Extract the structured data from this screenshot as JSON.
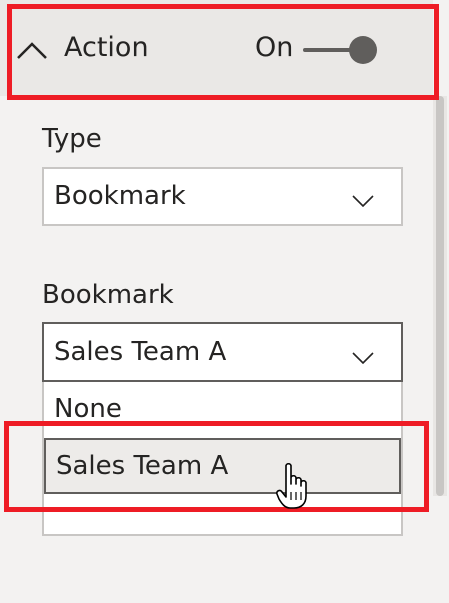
{
  "action": {
    "title": "Action",
    "toggle_label": "On",
    "toggle_state": true,
    "chevron_icon": "chevron-up-icon"
  },
  "type_field": {
    "label": "Type",
    "selected": "Bookmark",
    "arrow_icon": "chevron-down-icon"
  },
  "bookmark_field": {
    "label": "Bookmark",
    "selected": "Sales Team A",
    "arrow_icon": "chevron-down-icon",
    "options": [
      "None",
      "Sales Team A"
    ],
    "hovered_option": "Sales Team A"
  },
  "colors": {
    "highlight_box": "#ee1c25",
    "panel_bg": "#f3f2f1",
    "hover_bg": "#edebe9",
    "text": "#252423"
  },
  "cursor_icon": "hand-pointer-icon"
}
